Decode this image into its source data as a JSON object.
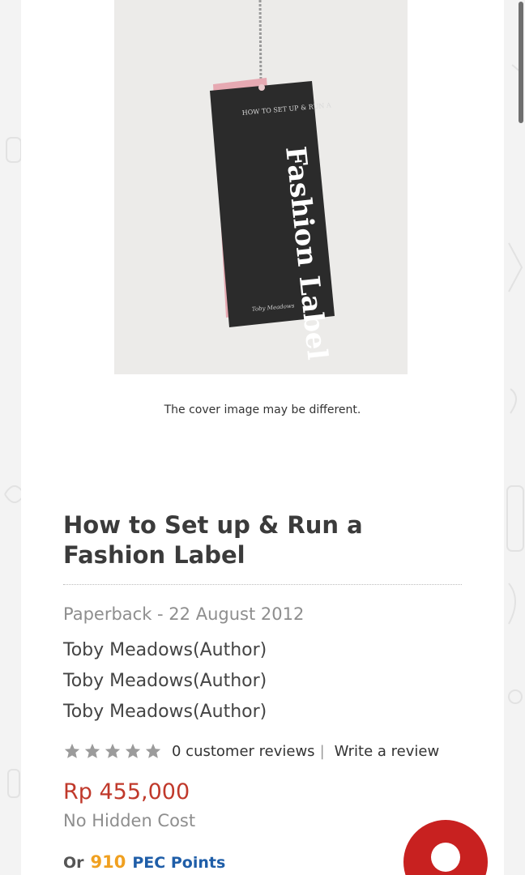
{
  "cover": {
    "note": "The cover image may be different.",
    "art_small_text": "HOW TO SET UP & RUN A",
    "art_big_title": "Fashion Label",
    "art_author": "Toby Meadows"
  },
  "product": {
    "title": "How to Set up & Run a Fashion Label",
    "format_line": "Paperback - 22 August 2012",
    "authors": [
      "Toby Meadows(Author)",
      "Toby Meadows(Author)",
      "Toby Meadows(Author)"
    ],
    "rating": 0,
    "reviews_label": "0 customer reviews",
    "separator": "|",
    "write_review_label": "Write a review",
    "price": "Rp 455,000",
    "no_hidden_cost": "No Hidden Cost",
    "points": {
      "prefix": "Or",
      "value": "910",
      "label": "PEC Points"
    }
  },
  "colors": {
    "price": "#c0392b",
    "points_value": "#f0a020",
    "points_label": "#1f5ea8",
    "chat_button": "#c82120"
  }
}
